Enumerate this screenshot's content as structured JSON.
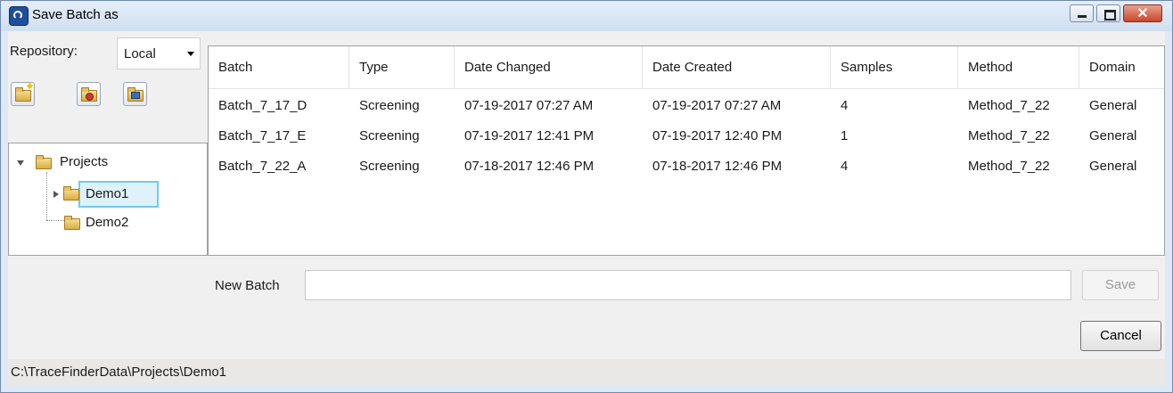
{
  "window": {
    "title": "Save Batch as"
  },
  "repository": {
    "label": "Repository:",
    "value": "Local"
  },
  "toolbar": [
    {
      "icon": "new-folder-icon"
    },
    {
      "icon": "delete-folder-icon"
    },
    {
      "icon": "rename-folder-icon"
    }
  ],
  "tree": {
    "root": "Projects",
    "children": [
      "Demo1",
      "Demo2"
    ],
    "selected": "Demo1"
  },
  "table": {
    "columns": [
      "Batch",
      "Type",
      "Date Changed",
      "Date Created",
      "Samples",
      "Method",
      "Domain"
    ],
    "rows": [
      [
        "Batch_7_17_D",
        "Screening",
        "07-19-2017 07:27 AM",
        "07-19-2017 07:27 AM",
        "4",
        "Method_7_22",
        "General"
      ],
      [
        "Batch_7_17_E",
        "Screening",
        "07-19-2017 12:41 PM",
        "07-19-2017 12:40 PM",
        "1",
        "Method_7_22",
        "General"
      ],
      [
        "Batch_7_22_A",
        "Screening",
        "07-18-2017 12:46 PM",
        "07-18-2017 12:46 PM",
        "4",
        "Method_7_22",
        "General"
      ]
    ]
  },
  "new_batch": {
    "label": "New Batch",
    "value": ""
  },
  "buttons": {
    "save": "Save",
    "cancel": "Cancel"
  },
  "status": {
    "path": "C:\\TraceFinderData\\Projects\\Demo1"
  }
}
